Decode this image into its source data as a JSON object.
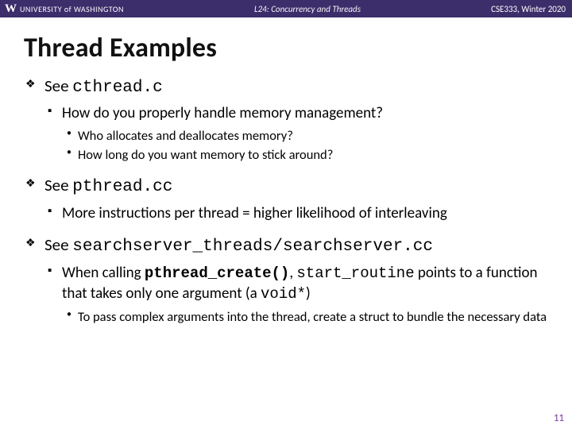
{
  "topbar": {
    "logo_letter": "W",
    "university": "UNIVERSITY of WASHINGTON",
    "lecture": "L24:  Concurrency and Threads",
    "course": "CSE333, Winter 2020"
  },
  "title": "Thread Examples",
  "items": [
    {
      "lead": "See ",
      "code": "cthread.c",
      "sub": [
        {
          "text": "How do you properly handle memory management?",
          "sub": [
            {
              "text": "Who allocates and deallocates memory?"
            },
            {
              "text": "How long do you want memory to stick around?"
            }
          ]
        }
      ]
    },
    {
      "lead": "See ",
      "code": "pthread.cc",
      "sub": [
        {
          "text": "More instructions per thread = higher likelihood of interleaving"
        }
      ]
    },
    {
      "lead": "See ",
      "code": "searchserver_threads/searchserver.cc",
      "sub": [
        {
          "pre": "When calling ",
          "code1": "pthread_create()",
          "mid": ", ",
          "code2": "start_routine",
          "post1": " points to a function that takes only one argument (a ",
          "code3": "void*",
          "post2": ")",
          "sub": [
            {
              "text": "To pass complex arguments into the thread, create a struct to bundle the necessary data"
            }
          ]
        }
      ]
    }
  ],
  "slide_number": "11"
}
